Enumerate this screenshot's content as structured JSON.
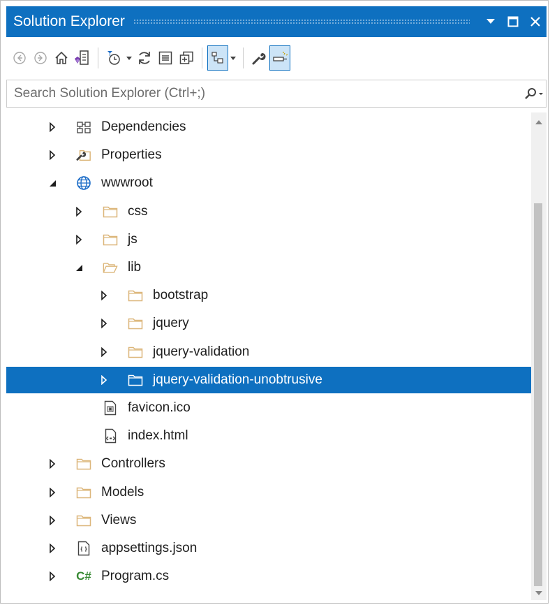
{
  "window": {
    "title": "Solution Explorer"
  },
  "titlebar_buttons": [
    "dropdown-arrow-icon",
    "maximize-icon",
    "close-icon"
  ],
  "toolbar": {
    "buttons": [
      "back-icon",
      "forward-icon",
      "home-icon",
      "switch-views-icon",
      "pending-changes-filter-icon",
      "sync-icon",
      "collapse-all-icon",
      "show-all-files-icon",
      "preview-selected-items-icon",
      "properties-icon",
      "pin-icon"
    ]
  },
  "search": {
    "placeholder": "Search Solution Explorer (Ctrl+;)",
    "value": ""
  },
  "tree": {
    "items": [
      {
        "label": "Dependencies",
        "expander": "collapsed",
        "icon": "dependencies-icon",
        "level": 1
      },
      {
        "label": "Properties",
        "expander": "collapsed",
        "icon": "properties-folder-icon",
        "level": 1
      },
      {
        "label": "wwwroot",
        "expander": "expanded",
        "icon": "globe-icon",
        "level": 1
      },
      {
        "label": "css",
        "expander": "collapsed",
        "icon": "folder-icon",
        "level": 2
      },
      {
        "label": "js",
        "expander": "collapsed",
        "icon": "folder-icon",
        "level": 2
      },
      {
        "label": "lib",
        "expander": "expanded",
        "icon": "folder-open-icon",
        "level": 2
      },
      {
        "label": "bootstrap",
        "expander": "collapsed",
        "icon": "folder-icon",
        "level": 3
      },
      {
        "label": "jquery",
        "expander": "collapsed",
        "icon": "folder-icon",
        "level": 3
      },
      {
        "label": "jquery-validation",
        "expander": "collapsed",
        "icon": "folder-icon",
        "level": 3
      },
      {
        "label": "jquery-validation-unobtrusive",
        "expander": "collapsed",
        "icon": "folder-icon",
        "level": 3,
        "selected": true
      },
      {
        "label": "favicon.ico",
        "expander": "none",
        "icon": "image-file-icon",
        "level": 2
      },
      {
        "label": "index.html",
        "expander": "none",
        "icon": "html-file-icon",
        "level": 2
      },
      {
        "label": "Controllers",
        "expander": "collapsed",
        "icon": "folder-icon",
        "level": 1
      },
      {
        "label": "Models",
        "expander": "collapsed",
        "icon": "folder-icon",
        "level": 1
      },
      {
        "label": "Views",
        "expander": "collapsed",
        "icon": "folder-icon",
        "level": 1
      },
      {
        "label": "appsettings.json",
        "expander": "collapsed",
        "icon": "json-file-icon",
        "level": 1
      },
      {
        "label": "Program.cs",
        "expander": "collapsed",
        "icon": "csharp-file-icon",
        "level": 1,
        "icon_text": "C#"
      }
    ]
  },
  "colors": {
    "accent": "#0e70c0",
    "selection_text": "#ffffff",
    "folder": "#dcb67a",
    "csharp": "#388a34"
  }
}
